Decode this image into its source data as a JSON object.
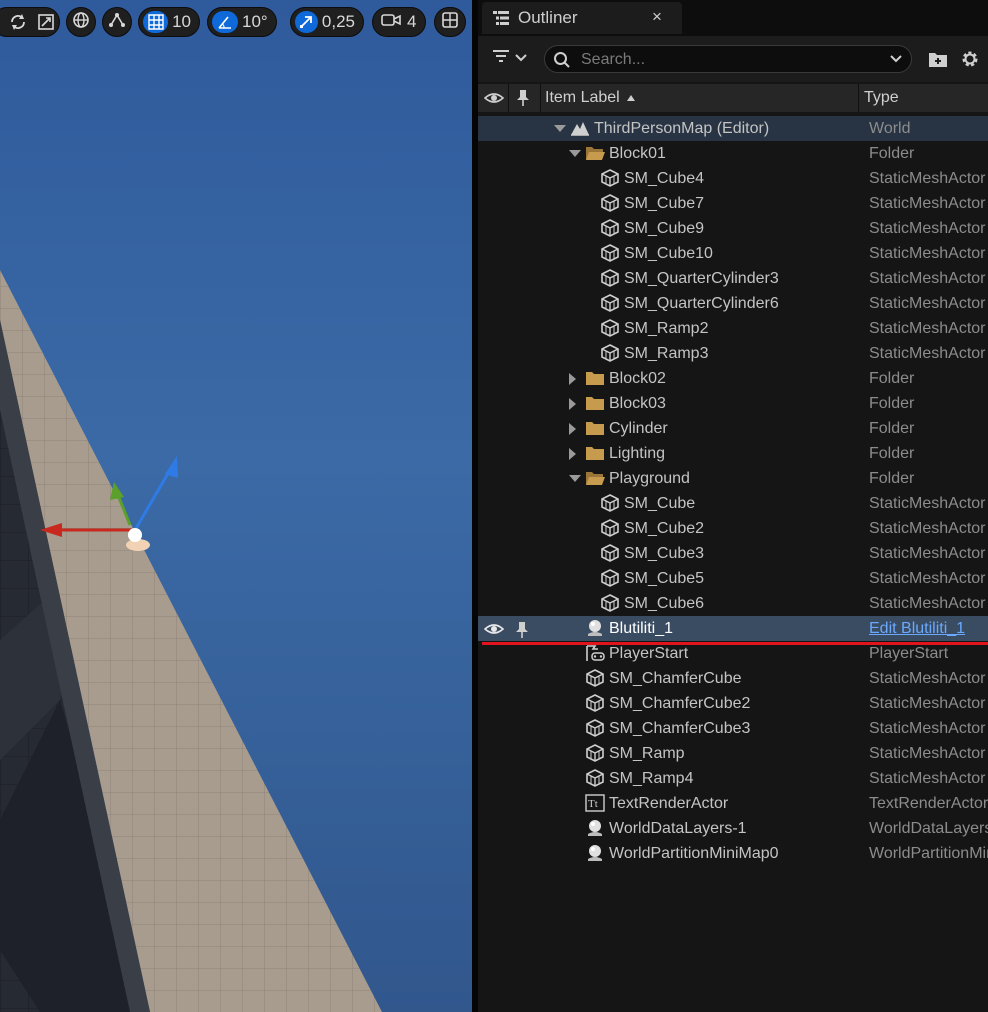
{
  "viewport": {
    "toolbar": {
      "grid_snap_value": "10",
      "rotation_snap_value": "10°",
      "scale_snap_value": "0,25",
      "camera_speed_value": "4"
    }
  },
  "outliner": {
    "tab_title": "Outliner",
    "tab_close": "×",
    "search_placeholder": "Search...",
    "columns": {
      "label": "Item Label",
      "type": "Type"
    },
    "rows": [
      {
        "label": "ThirdPersonMap (Editor)",
        "type": "World",
        "icon": "world-icon"
      },
      {
        "label": "Block01",
        "type": "Folder",
        "icon": "folder-open-icon"
      },
      {
        "label": "SM_Cube4",
        "type": "StaticMeshActor",
        "icon": "static-mesh-icon"
      },
      {
        "label": "SM_Cube7",
        "type": "StaticMeshActor",
        "icon": "static-mesh-icon"
      },
      {
        "label": "SM_Cube9",
        "type": "StaticMeshActor",
        "icon": "static-mesh-icon"
      },
      {
        "label": "SM_Cube10",
        "type": "StaticMeshActor",
        "icon": "static-mesh-icon"
      },
      {
        "label": "SM_QuarterCylinder3",
        "type": "StaticMeshActor",
        "icon": "static-mesh-icon"
      },
      {
        "label": "SM_QuarterCylinder6",
        "type": "StaticMeshActor",
        "icon": "static-mesh-icon"
      },
      {
        "label": "SM_Ramp2",
        "type": "StaticMeshActor",
        "icon": "static-mesh-icon"
      },
      {
        "label": "SM_Ramp3",
        "type": "StaticMeshActor",
        "icon": "static-mesh-icon"
      },
      {
        "label": "Block02",
        "type": "Folder",
        "icon": "folder-icon"
      },
      {
        "label": "Block03",
        "type": "Folder",
        "icon": "folder-icon"
      },
      {
        "label": "Cylinder",
        "type": "Folder",
        "icon": "folder-icon"
      },
      {
        "label": "Lighting",
        "type": "Folder",
        "icon": "folder-icon"
      },
      {
        "label": "Playground",
        "type": "Folder",
        "icon": "folder-open-icon"
      },
      {
        "label": "SM_Cube",
        "type": "StaticMeshActor",
        "icon": "static-mesh-icon"
      },
      {
        "label": "SM_Cube2",
        "type": "StaticMeshActor",
        "icon": "static-mesh-icon"
      },
      {
        "label": "SM_Cube3",
        "type": "StaticMeshActor",
        "icon": "static-mesh-icon"
      },
      {
        "label": "SM_Cube5",
        "type": "StaticMeshActor",
        "icon": "static-mesh-icon"
      },
      {
        "label": "SM_Cube6",
        "type": "StaticMeshActor",
        "icon": "static-mesh-icon"
      },
      {
        "label": "Blutiliti_1",
        "type": "Edit Blutiliti_1",
        "icon": "actor-icon",
        "selected": true
      },
      {
        "label": "PlayerStart",
        "type": "PlayerStart",
        "icon": "player-start-icon"
      },
      {
        "label": "SM_ChamferCube",
        "type": "StaticMeshActor",
        "icon": "static-mesh-icon"
      },
      {
        "label": "SM_ChamferCube2",
        "type": "StaticMeshActor",
        "icon": "static-mesh-icon"
      },
      {
        "label": "SM_ChamferCube3",
        "type": "StaticMeshActor",
        "icon": "static-mesh-icon"
      },
      {
        "label": "SM_Ramp",
        "type": "StaticMeshActor",
        "icon": "static-mesh-icon"
      },
      {
        "label": "SM_Ramp4",
        "type": "StaticMeshActor",
        "icon": "static-mesh-icon"
      },
      {
        "label": "TextRenderActor",
        "type": "TextRenderActor",
        "icon": "text-render-icon"
      },
      {
        "label": "WorldDataLayers-1",
        "type": "WorldDataLayers",
        "icon": "actor-icon"
      },
      {
        "label": "WorldPartitionMiniMap0",
        "type": "WorldPartitionMiniMap",
        "icon": "actor-icon"
      }
    ]
  },
  "colors": {
    "accent": "#0f69d9",
    "selection_row": "#3a4c62",
    "highlight_underline": "#e0141e",
    "link": "#6aa9ff"
  }
}
